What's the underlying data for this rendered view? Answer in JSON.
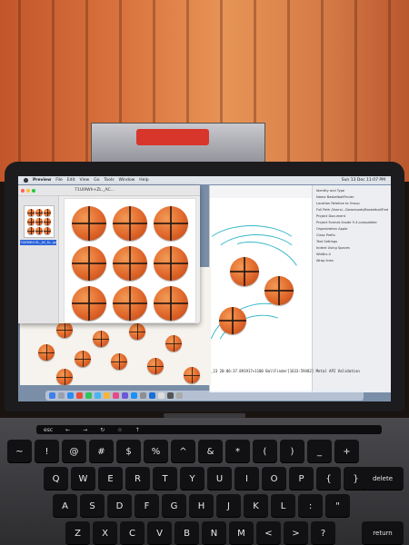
{
  "menubar": {
    "app_name": "Preview",
    "items": [
      "File",
      "Edit",
      "View",
      "Go",
      "Tools",
      "Window",
      "Help"
    ],
    "clock": "Sun 13 Dec 11:07 PM"
  },
  "preview_window": {
    "title": "71Ui9Wh+ZL._AC...",
    "thumbnail_label": "71Ui9Wh+ZL._AC_SL...jpg"
  },
  "inspector": {
    "lines": [
      "Identity and Type",
      "Name  BasketballFinder",
      "Location  Relative to Group",
      "Full Path  /Users/...Downloads/BasketballFinder",
      "Project Document",
      "Project Format  Xcode 9.3-compatible",
      "Organization  Apple",
      "Class Prefix",
      "Text Settings",
      "Indent Using  Spaces",
      "Widths  4",
      "Wrap lines"
    ]
  },
  "console_text": "_23 20:06:37.891917+1100 BallFinder[1633:59482] Metal API Validation",
  "touchbar": {
    "items": [
      "esc",
      "←",
      "→",
      "↻",
      "☆",
      "↑"
    ]
  },
  "keyboard": {
    "row_numbers": [
      "~",
      "!",
      "@",
      "#",
      "$",
      "%",
      "^",
      "&",
      "*",
      "(",
      ")",
      "_",
      "+"
    ],
    "row_q": [
      "Q",
      "W",
      "E",
      "R",
      "T",
      "Y",
      "U",
      "I",
      "O",
      "P",
      "{",
      "}"
    ],
    "row_a": [
      "A",
      "S",
      "D",
      "F",
      "G",
      "H",
      "J",
      "K",
      "L",
      ":",
      "\""
    ],
    "row_z": [
      "Z",
      "X",
      "C",
      "V",
      "B",
      "N",
      "M",
      "<",
      ">",
      "?"
    ],
    "delete": "delete",
    "return": "return"
  },
  "colors": {
    "ball": "#e0672a",
    "wall": "#d9733e",
    "accent_swirl": "#35b8c8"
  }
}
